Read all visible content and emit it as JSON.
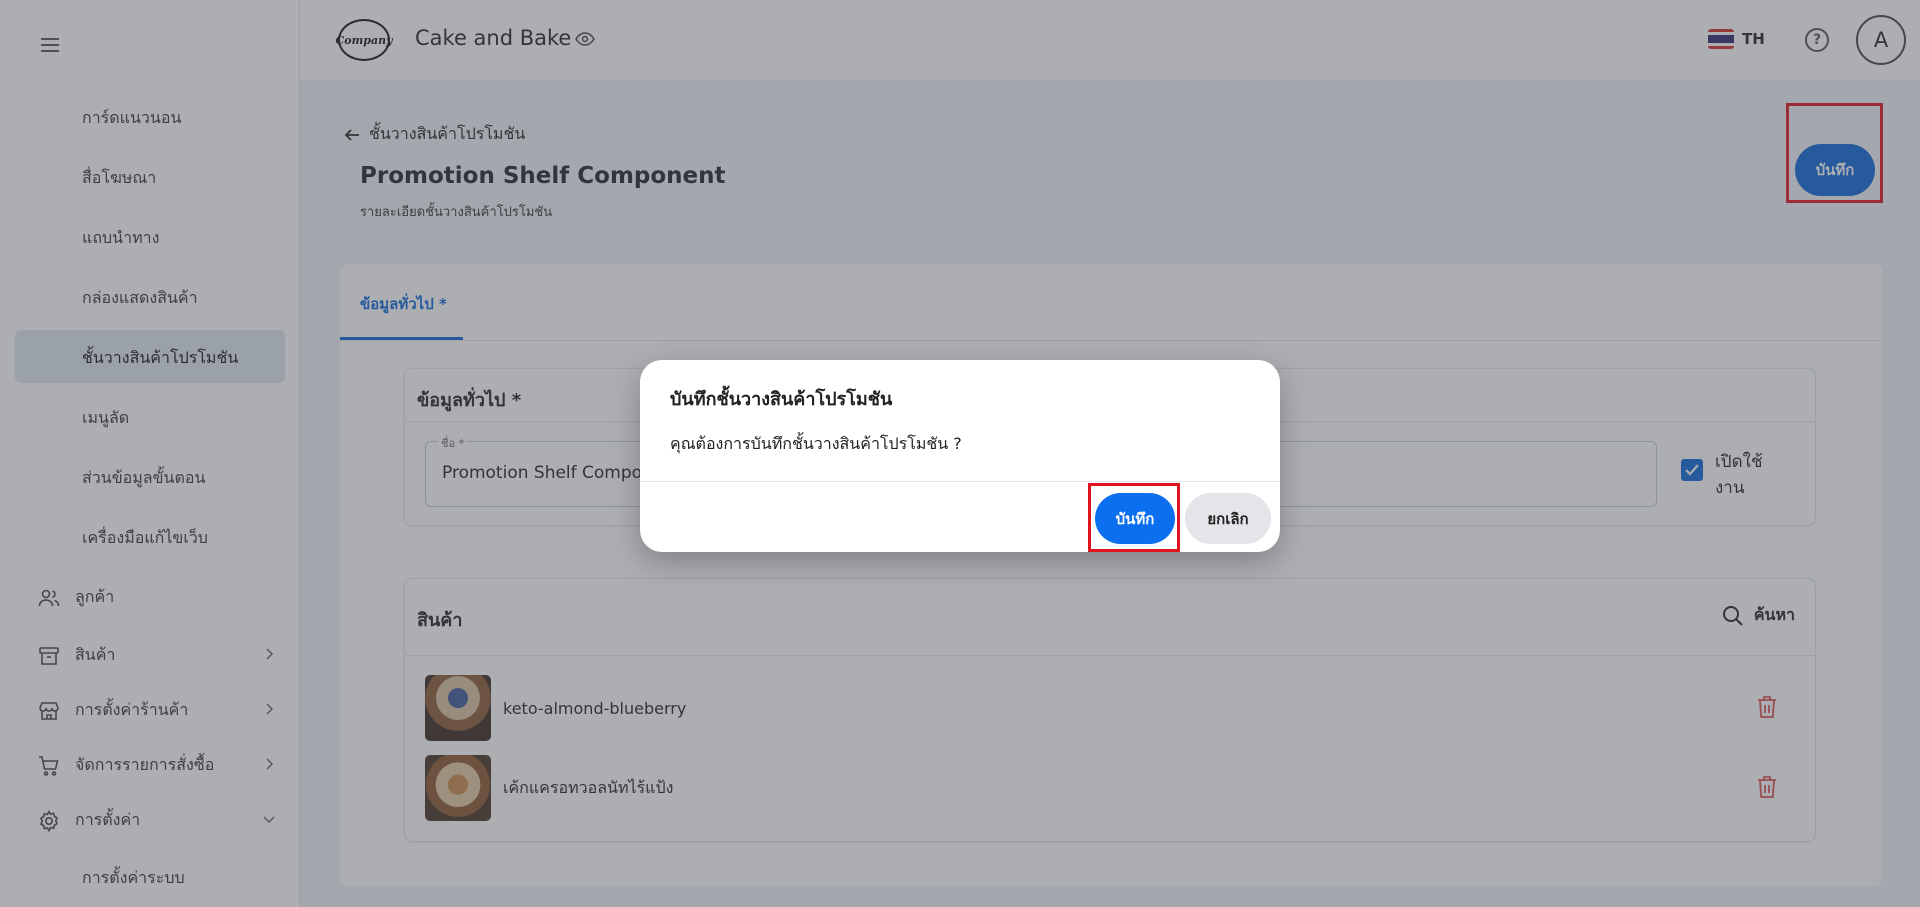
{
  "header": {
    "logo_text": "Company",
    "store_name": "Cake and Bake",
    "language": "TH",
    "avatar_letter": "A",
    "flag_colors": [
      "#d62b2b",
      "#ffffff",
      "#2d2a6e",
      "#ffffff",
      "#d62b2b"
    ]
  },
  "sidebar": {
    "sub_items": [
      {
        "label": "การ์ดแนวนอน"
      },
      {
        "label": "สื่อโฆษณา"
      },
      {
        "label": "แถบนำทาง"
      },
      {
        "label": "กล่องแสดงสินค้า"
      },
      {
        "label": "ชั้นวางสินค้าโปรโมชัน",
        "active": true
      },
      {
        "label": "เมนูลัด"
      },
      {
        "label": "ส่วนข้อมูลขั้นตอน"
      },
      {
        "label": "เครื่องมือแก้ไขเว็บ"
      }
    ],
    "main_items": [
      {
        "label": "ลูกค้า",
        "icon": "users-icon"
      },
      {
        "label": "สินค้า",
        "icon": "archive-box-icon",
        "chevron": "right"
      },
      {
        "label": "การตั้งค่าร้านค้า",
        "icon": "storefront-icon",
        "chevron": "right"
      },
      {
        "label": "จัดการรายการสั่งซื้อ",
        "icon": "cart-icon",
        "chevron": "right"
      },
      {
        "label": "การตั้งค่า",
        "icon": "gear-icon",
        "chevron": "down"
      }
    ],
    "bottom_sub_item": "การตั้งค่าระบบ"
  },
  "page": {
    "back_label": "ชั้นวางสินค้าโปรโมชัน",
    "title": "Promotion Shelf Component",
    "subtitle": "รายละเอียดชั้นวางสินค้าโปรโมชัน",
    "save_label": "บันทึก",
    "tab_label": "ข้อมูลทั่วไป *"
  },
  "general_section": {
    "title": "ข้อมูลทั่วไป *",
    "name_label": "ชื่อ *",
    "name_value": "Promotion Shelf Component",
    "enabled_label": "เปิดใช้งาน",
    "enabled": true
  },
  "products_section": {
    "title": "สินค้า",
    "search_label": "ค้นหา",
    "items": [
      {
        "name": "keto-almond-blueberry"
      },
      {
        "name": "เค้กแครอทวอลนัทไร้แป้ง"
      }
    ]
  },
  "dialog": {
    "title": "บันทึกชั้นวางสินค้าโปรโมชัน",
    "message": "คุณต้องการบันทึกชั้นวางสินค้าโปรโมชัน ?",
    "confirm_label": "บันทึก",
    "cancel_label": "ยกเลิก"
  },
  "colors": {
    "primary": "#0b66d8",
    "highlight": "#e0141e",
    "danger": "#d9534f"
  }
}
